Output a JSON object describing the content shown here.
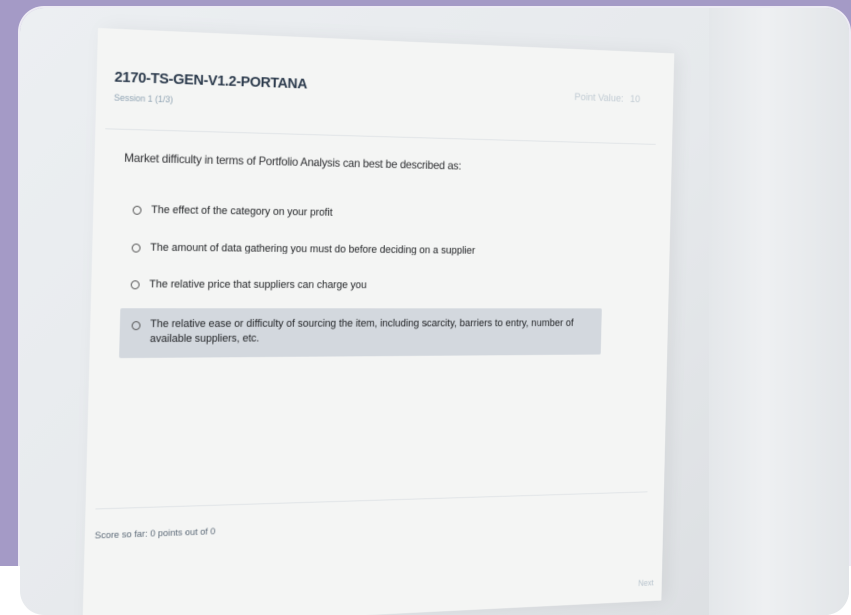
{
  "quiz": {
    "title": "2170-TS-GEN-V1.2-PORTANA",
    "session": "Session 1 (1/3)",
    "points_label": "Point Value:",
    "points_value": "10"
  },
  "question": {
    "text": "Market difficulty in terms of Portfolio Analysis can best be described as:",
    "options": [
      {
        "label": "The effect of the category on your profit",
        "selected": false
      },
      {
        "label": "The amount of data gathering you must do before deciding on a supplier",
        "selected": false
      },
      {
        "label": "The relative price that suppliers can charge you",
        "selected": false
      },
      {
        "label": "The relative ease or difficulty of sourcing the item, including scarcity, barriers to entry, number of available suppliers, etc.",
        "selected": true
      }
    ]
  },
  "score": {
    "text": "Score so far: 0 points out of 0"
  },
  "footer": {
    "next_label": "Next"
  }
}
